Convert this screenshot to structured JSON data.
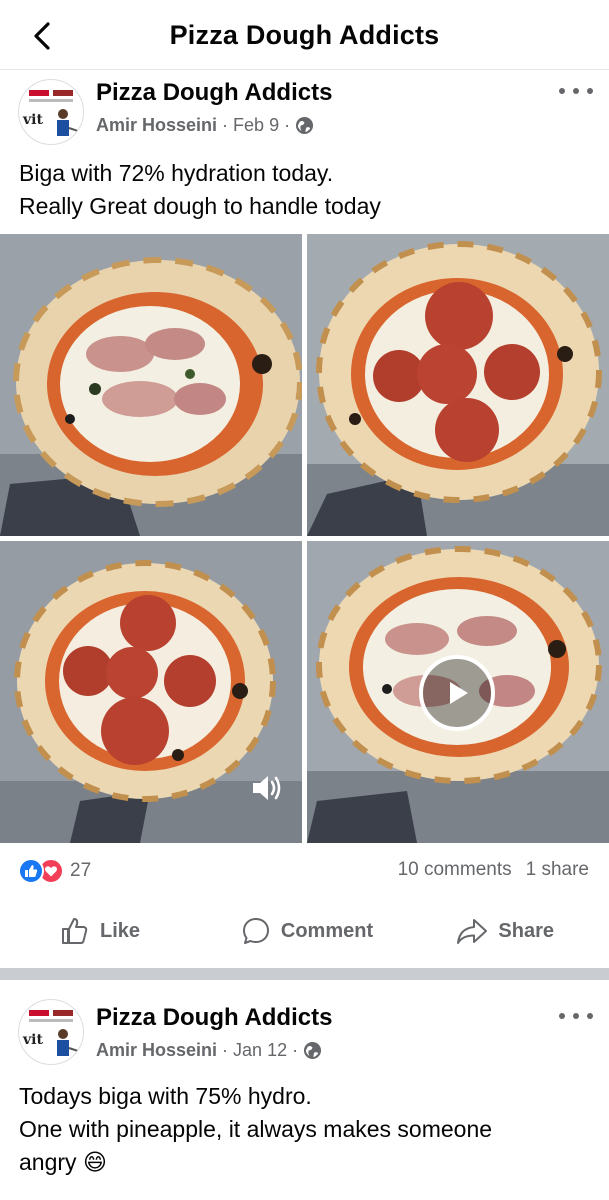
{
  "header": {
    "title": "Pizza Dough Addicts",
    "back_icon": "chevron-left-icon"
  },
  "colors": {
    "facebook_blue": "#1877f2",
    "love_red": "#f33e58",
    "secondary_text": "#65676b",
    "separator": "#c9ccd1"
  },
  "posts": [
    {
      "group_name": "Pizza Dough Addicts",
      "author": "Amir Hosseini",
      "date": "Feb 9",
      "dot": "·",
      "privacy_icon": "globe-icon",
      "text_lines": [
        "Biga with 72% hydration today.",
        "Really Great dough to handle today"
      ],
      "photos": [
        "pizza-ham",
        "pizza-salami",
        "pizza-salami",
        "pizza-ham-video"
      ],
      "reaction_count": "27",
      "comments": "10 comments",
      "shares": "1 share",
      "actions": {
        "like": "Like",
        "comment": "Comment",
        "share": "Share"
      }
    },
    {
      "group_name": "Pizza Dough Addicts",
      "author": "Amir Hosseini",
      "date": "Jan 12",
      "dot": "·",
      "privacy_icon": "globe-icon",
      "text_lines": [
        "Todays biga with 75% hydro.",
        "One with pineapple, it always makes someone",
        "angry"
      ],
      "emoji": "😄"
    }
  ]
}
